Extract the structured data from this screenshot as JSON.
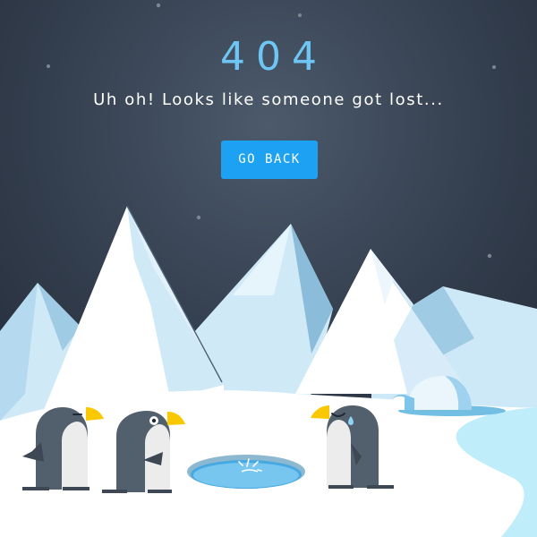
{
  "error": {
    "code": "404",
    "message": "Uh oh! Looks like someone got lost..."
  },
  "actions": {
    "back_label": "GO BACK"
  },
  "colors": {
    "sky_top": "#262f3c",
    "sky_glow": "#4c5a6b",
    "code_text": "#6ec6f5",
    "button": "#1da1f2",
    "snow": "#ffffff",
    "ice_water": "#bfeefa",
    "penguin_body": "#525f6c",
    "penguin_beak": "#f9c800"
  },
  "illustration": {
    "scene": "snowy-mountains",
    "characters": [
      "penguin-sleepy",
      "penguin-surprised",
      "penguin-crying"
    ],
    "objects": [
      "ice-hole",
      "igloo"
    ]
  }
}
